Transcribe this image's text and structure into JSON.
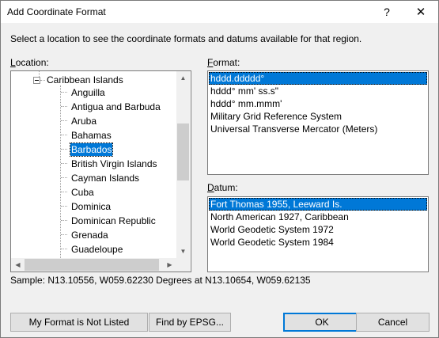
{
  "window": {
    "title": "Add Coordinate Format",
    "help_glyph": "?",
    "close_glyph": "✕"
  },
  "description": "Select a location to see the coordinate formats and datums available for that region.",
  "location": {
    "label_underline": "L",
    "label_rest": "ocation:",
    "parent": "Caribbean Islands",
    "items": [
      {
        "label": "Anguilla",
        "selected": false
      },
      {
        "label": "Antigua and Barbuda",
        "selected": false
      },
      {
        "label": "Aruba",
        "selected": false
      },
      {
        "label": "Bahamas",
        "selected": false
      },
      {
        "label": "Barbados",
        "selected": true
      },
      {
        "label": "British Virgin Islands",
        "selected": false
      },
      {
        "label": "Cayman Islands",
        "selected": false
      },
      {
        "label": "Cuba",
        "selected": false
      },
      {
        "label": "Dominica",
        "selected": false
      },
      {
        "label": "Dominican Republic",
        "selected": false
      },
      {
        "label": "Grenada",
        "selected": false
      },
      {
        "label": "Guadeloupe",
        "selected": false
      }
    ],
    "scroll_up": "▲",
    "scroll_down": "▼",
    "scroll_left": "◀",
    "scroll_right": "▶"
  },
  "format": {
    "label_underline": "F",
    "label_rest": "ormat:",
    "items": [
      {
        "label": "hddd.ddddd°",
        "selected": true
      },
      {
        "label": "hddd° mm' ss.s\"",
        "selected": false
      },
      {
        "label": "hddd° mm.mmm'",
        "selected": false
      },
      {
        "label": "Military Grid Reference System",
        "selected": false
      },
      {
        "label": "Universal Transverse Mercator (Meters)",
        "selected": false
      }
    ]
  },
  "datum": {
    "label_underline": "D",
    "label_rest": "atum:",
    "items": [
      {
        "label": "Fort Thomas 1955, Leeward Is.",
        "selected": true
      },
      {
        "label": "North American 1927, Caribbean",
        "selected": false
      },
      {
        "label": "World Geodetic System 1972",
        "selected": false
      },
      {
        "label": "World Geodetic System 1984",
        "selected": false
      }
    ]
  },
  "sample": "Sample: N13.10556, W059.62230 Degrees at N13.10654, W059.62135",
  "buttons": {
    "not_listed": "My Format is Not Listed",
    "epsg": "Find by EPSG...",
    "ok": "OK",
    "cancel": "Cancel"
  },
  "colors": {
    "selection": "#0078d7",
    "dialog_bg": "#f0f0f0"
  }
}
